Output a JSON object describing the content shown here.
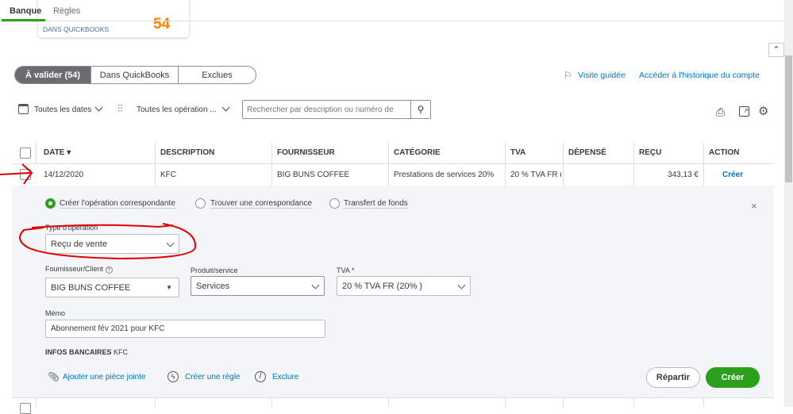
{
  "top_tabs": [
    {
      "label": "Banque",
      "active": true
    },
    {
      "label": "Règles"
    }
  ],
  "summary_card": {
    "label": "DANS QUICKBOOKS",
    "count": "54"
  },
  "segments": [
    "À valider (54)",
    "Dans QuickBooks",
    "Exclues"
  ],
  "links": {
    "guided": "Visite guidée",
    "history": "Accéder à l'historique du compte"
  },
  "filters": {
    "dates": "Toutes les dates",
    "operations": "Toutes les opération ...",
    "search_placeholder": "Rechercher par description ou numéro de"
  },
  "table": {
    "headers": [
      "DATE",
      "DESCRIPTION",
      "FOURNISSEUR",
      "CATÉGORIE",
      "TVA",
      "DÉPENSÉ",
      "REÇU",
      "ACTION"
    ],
    "row": {
      "date": "14/12/2020",
      "description": "KFC",
      "supplier": "BIG BUNS COFFEE",
      "category": "Prestations de services 20%",
      "tva": "20 % TVA FR (2",
      "spent": "",
      "received": "343,13 €",
      "action": "Créer"
    }
  },
  "panel": {
    "radios": [
      "Créer l'opération correspondante",
      "Trouver une correspondance",
      "Transfert de fonds"
    ],
    "type_label": "Type d'opération",
    "type_value": "Reçu de vente",
    "supplier_label": "Fournisseur/Client",
    "supplier_value": "BIG BUNS COFFEE",
    "product_label": "Produit/service",
    "product_value": "Services",
    "tva_label": "TVA *",
    "tva_value": "20 % TVA FR (20% )",
    "memo_label": "Mémo",
    "memo_value": "Abonnement fév 2021 pour KFC",
    "bank_info_label": "INFOS BANCAIRES",
    "bank_info_value": "KFC",
    "attach": "Ajouter une pièce jointe",
    "rule": "Créer une règle",
    "exclude": "Exclure",
    "split": "Répartir",
    "create": "Créer"
  },
  "colors": {
    "green": "#2ca01c",
    "blue": "#0077c5",
    "orange": "#ff8000",
    "annotation": "#e00000"
  }
}
